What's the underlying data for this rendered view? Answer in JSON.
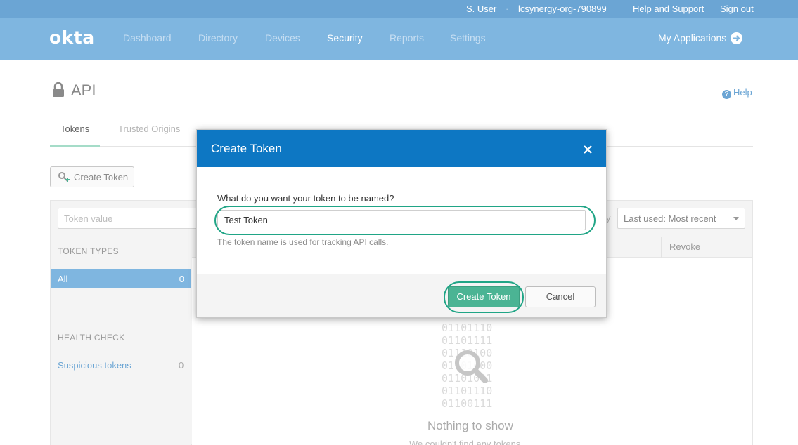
{
  "utility_bar": {
    "user": "S. User",
    "separator": "·",
    "org": "lcsynergy-org-790899",
    "help_support": "Help and Support",
    "sign_out": "Sign out"
  },
  "nav": {
    "logo": "okta",
    "items": [
      "Dashboard",
      "Directory",
      "Devices",
      "Security",
      "Reports",
      "Settings"
    ],
    "active": "Security",
    "my_applications": "My Applications"
  },
  "page": {
    "title": "API",
    "help": "Help",
    "tabs": [
      "Tokens",
      "Trusted Origins"
    ],
    "create_token_label": "Create Token"
  },
  "filters": {
    "token_placeholder": "Token value",
    "partial_text": "y",
    "sort_value": "Last used: Most recent"
  },
  "sidebar": {
    "token_types_heading": "TOKEN TYPES",
    "all_label": "All",
    "all_count": "0",
    "health_heading": "HEALTH CHECK",
    "suspicious_label": "Suspicious tokens",
    "suspicious_count": "0"
  },
  "table": {
    "revoke_header": "Revoke"
  },
  "empty_state": {
    "binary": [
      "01101110",
      "01101111",
      "01110100",
      "01101000",
      "01101001",
      "01101110",
      "01100111"
    ],
    "title": "Nothing to show",
    "subtitle": "We couldn't find any tokens"
  },
  "modal": {
    "title": "Create Token",
    "question": "What do you want your token to be named?",
    "input_value": "Test Token",
    "hint": "The token name is used for tracking API calls.",
    "create_label": "Create Token",
    "cancel_label": "Cancel"
  },
  "colors": {
    "nav_bg": "#7fb6e0",
    "modal_header": "#0d77c3",
    "primary_button": "#4bb494",
    "highlight_ring": "#20a586"
  }
}
